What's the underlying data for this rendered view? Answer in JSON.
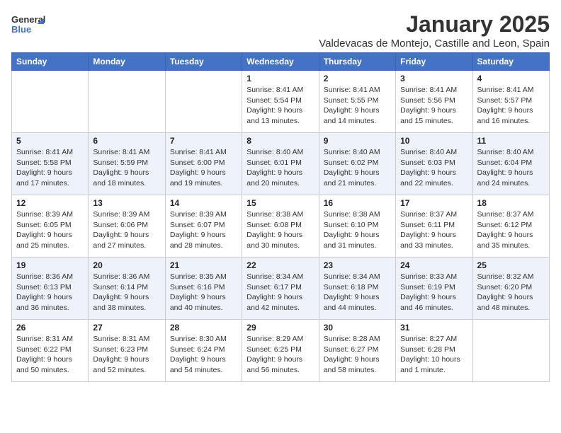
{
  "logo": {
    "general": "General",
    "blue": "Blue"
  },
  "title": "January 2025",
  "subtitle": "Valdevacas de Montejo, Castille and Leon, Spain",
  "days_of_week": [
    "Sunday",
    "Monday",
    "Tuesday",
    "Wednesday",
    "Thursday",
    "Friday",
    "Saturday"
  ],
  "weeks": [
    [
      {
        "day": "",
        "info": ""
      },
      {
        "day": "",
        "info": ""
      },
      {
        "day": "",
        "info": ""
      },
      {
        "day": "1",
        "info": "Sunrise: 8:41 AM\nSunset: 5:54 PM\nDaylight: 9 hours and 13 minutes."
      },
      {
        "day": "2",
        "info": "Sunrise: 8:41 AM\nSunset: 5:55 PM\nDaylight: 9 hours and 14 minutes."
      },
      {
        "day": "3",
        "info": "Sunrise: 8:41 AM\nSunset: 5:56 PM\nDaylight: 9 hours and 15 minutes."
      },
      {
        "day": "4",
        "info": "Sunrise: 8:41 AM\nSunset: 5:57 PM\nDaylight: 9 hours and 16 minutes."
      }
    ],
    [
      {
        "day": "5",
        "info": "Sunrise: 8:41 AM\nSunset: 5:58 PM\nDaylight: 9 hours and 17 minutes."
      },
      {
        "day": "6",
        "info": "Sunrise: 8:41 AM\nSunset: 5:59 PM\nDaylight: 9 hours and 18 minutes."
      },
      {
        "day": "7",
        "info": "Sunrise: 8:41 AM\nSunset: 6:00 PM\nDaylight: 9 hours and 19 minutes."
      },
      {
        "day": "8",
        "info": "Sunrise: 8:40 AM\nSunset: 6:01 PM\nDaylight: 9 hours and 20 minutes."
      },
      {
        "day": "9",
        "info": "Sunrise: 8:40 AM\nSunset: 6:02 PM\nDaylight: 9 hours and 21 minutes."
      },
      {
        "day": "10",
        "info": "Sunrise: 8:40 AM\nSunset: 6:03 PM\nDaylight: 9 hours and 22 minutes."
      },
      {
        "day": "11",
        "info": "Sunrise: 8:40 AM\nSunset: 6:04 PM\nDaylight: 9 hours and 24 minutes."
      }
    ],
    [
      {
        "day": "12",
        "info": "Sunrise: 8:39 AM\nSunset: 6:05 PM\nDaylight: 9 hours and 25 minutes."
      },
      {
        "day": "13",
        "info": "Sunrise: 8:39 AM\nSunset: 6:06 PM\nDaylight: 9 hours and 27 minutes."
      },
      {
        "day": "14",
        "info": "Sunrise: 8:39 AM\nSunset: 6:07 PM\nDaylight: 9 hours and 28 minutes."
      },
      {
        "day": "15",
        "info": "Sunrise: 8:38 AM\nSunset: 6:08 PM\nDaylight: 9 hours and 30 minutes."
      },
      {
        "day": "16",
        "info": "Sunrise: 8:38 AM\nSunset: 6:10 PM\nDaylight: 9 hours and 31 minutes."
      },
      {
        "day": "17",
        "info": "Sunrise: 8:37 AM\nSunset: 6:11 PM\nDaylight: 9 hours and 33 minutes."
      },
      {
        "day": "18",
        "info": "Sunrise: 8:37 AM\nSunset: 6:12 PM\nDaylight: 9 hours and 35 minutes."
      }
    ],
    [
      {
        "day": "19",
        "info": "Sunrise: 8:36 AM\nSunset: 6:13 PM\nDaylight: 9 hours and 36 minutes."
      },
      {
        "day": "20",
        "info": "Sunrise: 8:36 AM\nSunset: 6:14 PM\nDaylight: 9 hours and 38 minutes."
      },
      {
        "day": "21",
        "info": "Sunrise: 8:35 AM\nSunset: 6:16 PM\nDaylight: 9 hours and 40 minutes."
      },
      {
        "day": "22",
        "info": "Sunrise: 8:34 AM\nSunset: 6:17 PM\nDaylight: 9 hours and 42 minutes."
      },
      {
        "day": "23",
        "info": "Sunrise: 8:34 AM\nSunset: 6:18 PM\nDaylight: 9 hours and 44 minutes."
      },
      {
        "day": "24",
        "info": "Sunrise: 8:33 AM\nSunset: 6:19 PM\nDaylight: 9 hours and 46 minutes."
      },
      {
        "day": "25",
        "info": "Sunrise: 8:32 AM\nSunset: 6:20 PM\nDaylight: 9 hours and 48 minutes."
      }
    ],
    [
      {
        "day": "26",
        "info": "Sunrise: 8:31 AM\nSunset: 6:22 PM\nDaylight: 9 hours and 50 minutes."
      },
      {
        "day": "27",
        "info": "Sunrise: 8:31 AM\nSunset: 6:23 PM\nDaylight: 9 hours and 52 minutes."
      },
      {
        "day": "28",
        "info": "Sunrise: 8:30 AM\nSunset: 6:24 PM\nDaylight: 9 hours and 54 minutes."
      },
      {
        "day": "29",
        "info": "Sunrise: 8:29 AM\nSunset: 6:25 PM\nDaylight: 9 hours and 56 minutes."
      },
      {
        "day": "30",
        "info": "Sunrise: 8:28 AM\nSunset: 6:27 PM\nDaylight: 9 hours and 58 minutes."
      },
      {
        "day": "31",
        "info": "Sunrise: 8:27 AM\nSunset: 6:28 PM\nDaylight: 10 hours and 1 minute."
      },
      {
        "day": "",
        "info": ""
      }
    ]
  ]
}
